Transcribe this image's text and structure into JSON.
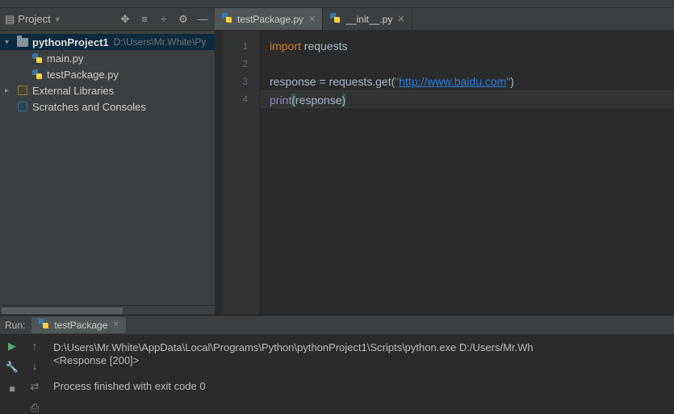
{
  "sidebar": {
    "title": "Project",
    "root": {
      "name": "pythonProject1",
      "path": "D:\\Users\\Mr.White\\Py"
    },
    "files": [
      {
        "name": "main.py"
      },
      {
        "name": "testPackage.py"
      }
    ],
    "extlib": "External Libraries",
    "scratches": "Scratches and Consoles"
  },
  "tabs": [
    {
      "name": "testPackage.py",
      "active": true
    },
    {
      "name": "__init__.py",
      "active": false
    }
  ],
  "code": {
    "l1_kw": "import",
    "l1_mod": " requests",
    "l3_a": "response = requests.get(",
    "l3_q1": "\"",
    "l3_url": "http://www.baidu.com",
    "l3_q2": "\"",
    "l3_b": ")",
    "l4_fn": "print",
    "l4_p1": "(",
    "l4_arg": "response",
    "l4_p2": ")"
  },
  "lines": [
    "1",
    "2",
    "3",
    "4"
  ],
  "run": {
    "label": "Run:",
    "tab": "testPackage",
    "out1": "D:\\Users\\Mr.White\\AppData\\Local\\Programs\\Python\\pythonProject1\\Scripts\\python.exe D:/Users/Mr.Wh",
    "out2": "<Response [200]>",
    "out3": "",
    "out4": "Process finished with exit code 0"
  }
}
